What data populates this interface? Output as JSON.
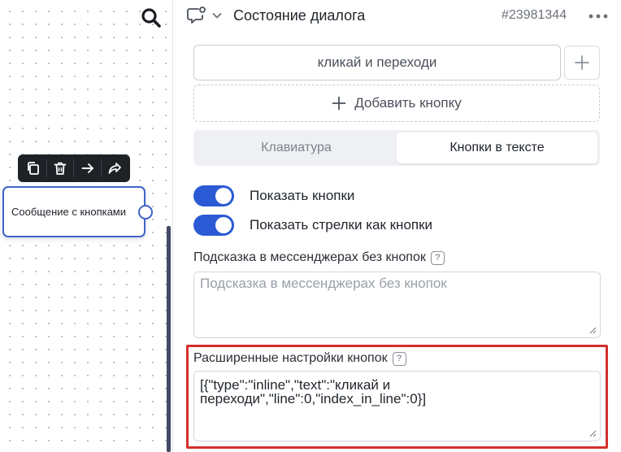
{
  "canvas": {
    "node": {
      "title": "Сообщение с кнопками"
    },
    "toolbar": [
      "copy-icon",
      "trash-icon",
      "arrow-right-icon",
      "share-icon"
    ]
  },
  "panel": {
    "header": {
      "title": "Состояние диалога",
      "id": "#23981344"
    },
    "buttons": {
      "existing_button_text": "кликай и переходи",
      "add_button_label": "Добавить кнопку"
    },
    "tabs": [
      {
        "label": "Клавиатура",
        "active": false
      },
      {
        "label": "Кнопки в тексте",
        "active": true
      }
    ],
    "toggles": [
      {
        "label": "Показать кнопки",
        "on": true
      },
      {
        "label": "Показать стрелки как кнопки",
        "on": true
      }
    ],
    "hint": {
      "label": "Подсказка в мессенджерах без кнопок",
      "placeholder": "Подсказка в мессенджерах без кнопок",
      "help": "?"
    },
    "advanced": {
      "label": "Расширенные настройки кнопок",
      "help": "?",
      "value": "[{\"type\":\"inline\",\"text\":\"кликай и переходи\",\"line\":0,\"index_in_line\":0}]"
    }
  },
  "colors": {
    "accent": "#2b5ad4",
    "node_border": "#3f64c9",
    "highlight_frame": "#d2302c",
    "toolbar_bg": "#1e2227"
  }
}
